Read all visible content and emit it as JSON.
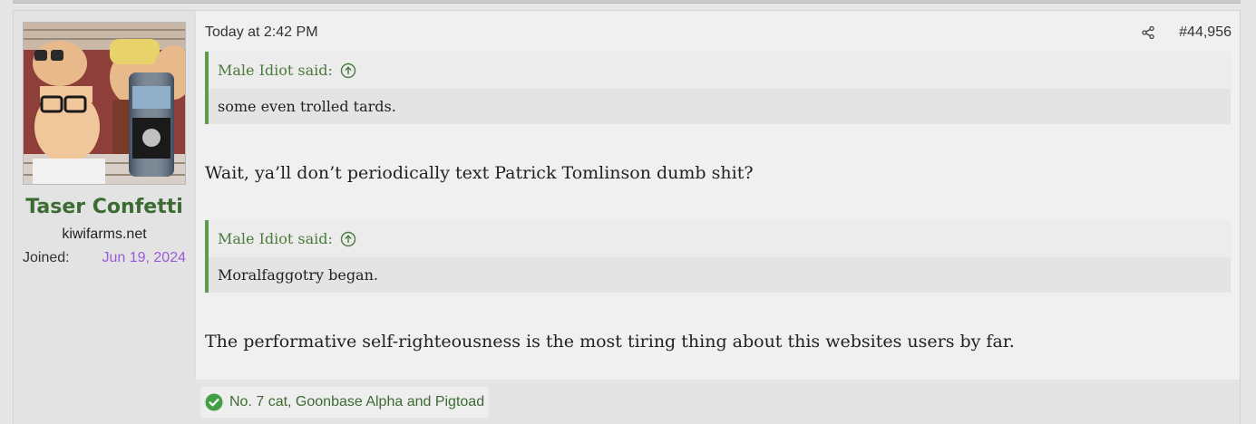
{
  "user": {
    "name": "Taser Confetti",
    "title": "kiwifarms.net",
    "joined_label": "Joined:",
    "joined_value": "Jun 19, 2024",
    "avatar_icon": "avatar-image"
  },
  "post": {
    "time": "Today at 2:42 PM",
    "number": "#44,956",
    "share_icon": "share-icon",
    "quotes": [
      {
        "author": "Male Idiot said:",
        "text": "some even trolled tards."
      },
      {
        "author": "Male Idiot said:",
        "text": "Moralfaggotry began."
      }
    ],
    "paragraphs": [
      "Wait, ya’ll don’t periodically text Patrick Tomlinson dumb shit?",
      "The performative self-righteousness is the most tiring thing about this websites users by far."
    ],
    "reactions_text": "No. 7 cat, Goonbase Alpha and Pigtoad"
  },
  "colors": {
    "accent_green": "#3d6b34",
    "quote_border": "#5f9a4f",
    "joined_date": "#9a5cd6"
  }
}
